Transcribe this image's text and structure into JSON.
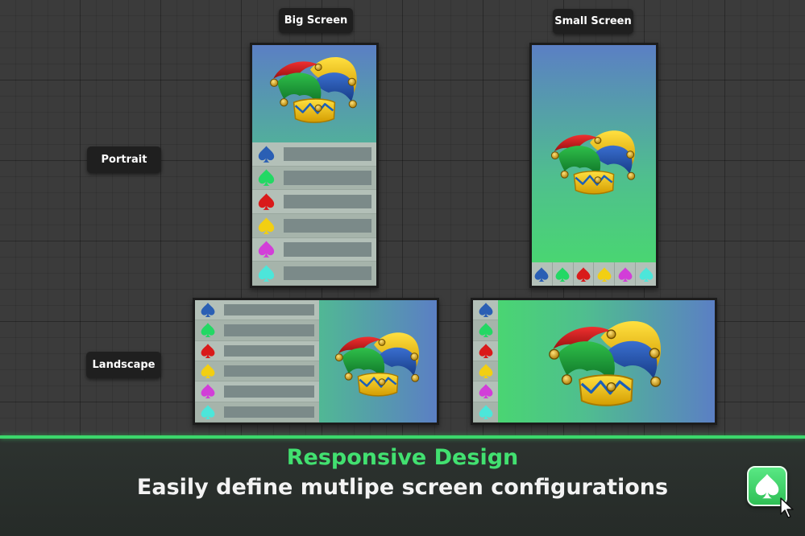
{
  "labels": {
    "big_screen": "Big Screen",
    "small_screen": "Small Screen",
    "portrait": "Portrait",
    "landscape": "Landscape"
  },
  "suits": [
    {
      "name": "blue-spade-icon",
      "color": "#2a5fb4"
    },
    {
      "name": "green-spade-icon",
      "color": "#23d864"
    },
    {
      "name": "red-spade-icon",
      "color": "#d91a1a"
    },
    {
      "name": "yellow-spade-icon",
      "color": "#f2cf12"
    },
    {
      "name": "magenta-spade-icon",
      "color": "#d23ed8"
    },
    {
      "name": "cyan-spade-icon",
      "color": "#4ce6da"
    }
  ],
  "footer": {
    "title": "Responsive Design",
    "subtitle": "Easily define mutlipe screen configurations"
  },
  "colors": {
    "accent": "#42e070",
    "background": "#3b3b3b",
    "gradient_blue": "#5b7fc4",
    "gradient_green": "#48dc6a"
  }
}
